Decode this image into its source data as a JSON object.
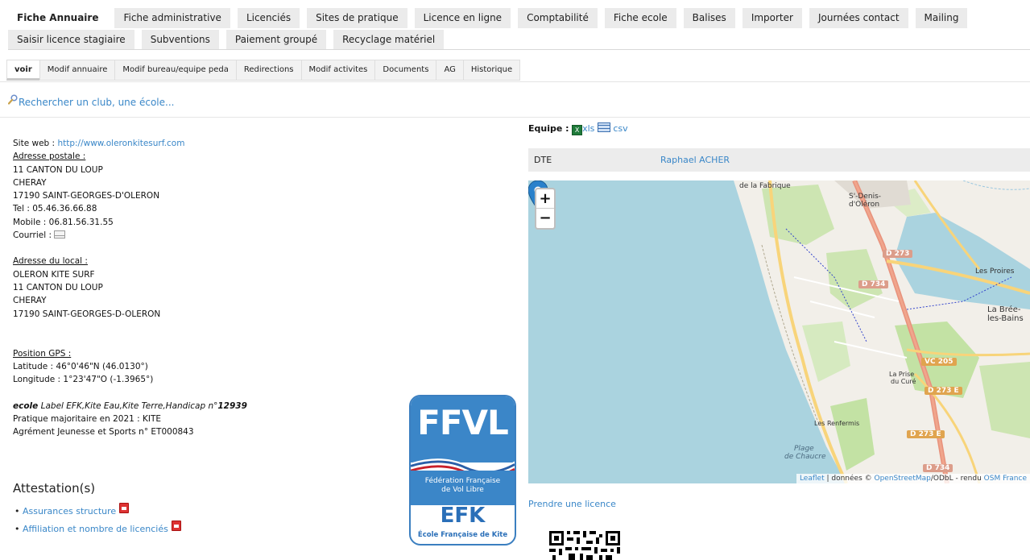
{
  "topnav": {
    "row1": [
      "Fiche Annuaire",
      "Fiche administrative",
      "Licenciés",
      "Sites de pratique",
      "Licence en ligne",
      "Comptabilité",
      "Fiche ecole",
      "Balises",
      "Importer",
      "Journées contact",
      "Mailing"
    ],
    "row2": [
      "Saisir licence stagiaire",
      "Subventions",
      "Paiement groupé",
      "Recyclage matériel"
    ],
    "active": "Fiche Annuaire"
  },
  "subnav": [
    "voir",
    "Modif annuaire",
    "Modif bureau/equipe peda",
    "Redirections",
    "Modif activites",
    "Documents",
    "AG",
    "Historique"
  ],
  "search": {
    "label": "Rechercher un club, une école..."
  },
  "info": {
    "site_label": "Site web : ",
    "site_url": "http://www.oleronkitesurf.com",
    "postal_title": "Adresse postale :",
    "postal_lines": [
      "11 CANTON DU LOUP",
      "CHERAY",
      "17190 SAINT-GEORGES-D'OLERON"
    ],
    "tel": "Tel : 05.46.36.66.88",
    "mobile": "Mobile : 06.81.56.31.55",
    "email_label": "Courriel : ",
    "local_title": "Adresse du local :",
    "local_lines": [
      "OLERON KITE SURF",
      "11 CANTON DU LOUP",
      "CHERAY",
      "17190 SAINT-GEORGES-D-OLERON"
    ],
    "gps_title": "Position GPS :",
    "latitude": "Latitude : 46°0'46\"N (46.0130°)",
    "longitude": "Longitude : 1°23'47\"O (-1.3965°)",
    "ecole_prefix": "ecole",
    "ecole_label": " Label EFK,Kite Eau,Kite Terre,Handicap n°",
    "ecole_number": "12939",
    "pratique": "Pratique majoritaire en 2021 : KITE",
    "agrement": "Agrément Jeunesse et Sports n° ET000843"
  },
  "attestation": {
    "title": "Attestation(s)",
    "items": [
      "Assurances structure",
      "Affiliation et nombre de licenciés"
    ]
  },
  "logo": {
    "ffvl": "FFVL",
    "federation": [
      "Fédération Française",
      "de Vol Libre"
    ],
    "efk": "EFK",
    "efk_sub": "École Française de Kite"
  },
  "equipe": {
    "label": "Equipe :",
    "xls": "xls",
    "csv": "csv",
    "role": "DTE",
    "name": "Raphael ACHER"
  },
  "map": {
    "labels": [
      "de la Fabrique",
      "S'-Denis-",
      "d'Oléron",
      "Les Proires",
      "La Brée-",
      "les-Bains",
      "La Prise",
      "du Curé",
      "Les Renfermis",
      "Plage",
      "de Chaucre"
    ],
    "roads": [
      "D 273",
      "D 734",
      "VC 205",
      "D 273 E",
      "D 273 E",
      "D 734"
    ],
    "zoom_in": "+",
    "zoom_out": "−",
    "attribution_leaflet": "Leaflet",
    "attribution_mid": " | données © ",
    "attribution_osm": "OpenStreetMap",
    "attribution_odbl": "/ODbL - rendu ",
    "attribution_osmfr": "OSM France",
    "colors": {
      "water": "#aad3df",
      "land": "#f2efe9",
      "green": "#c8e6a8",
      "road": "#e8927c"
    }
  },
  "prendre_licence": "Prendre une licence"
}
